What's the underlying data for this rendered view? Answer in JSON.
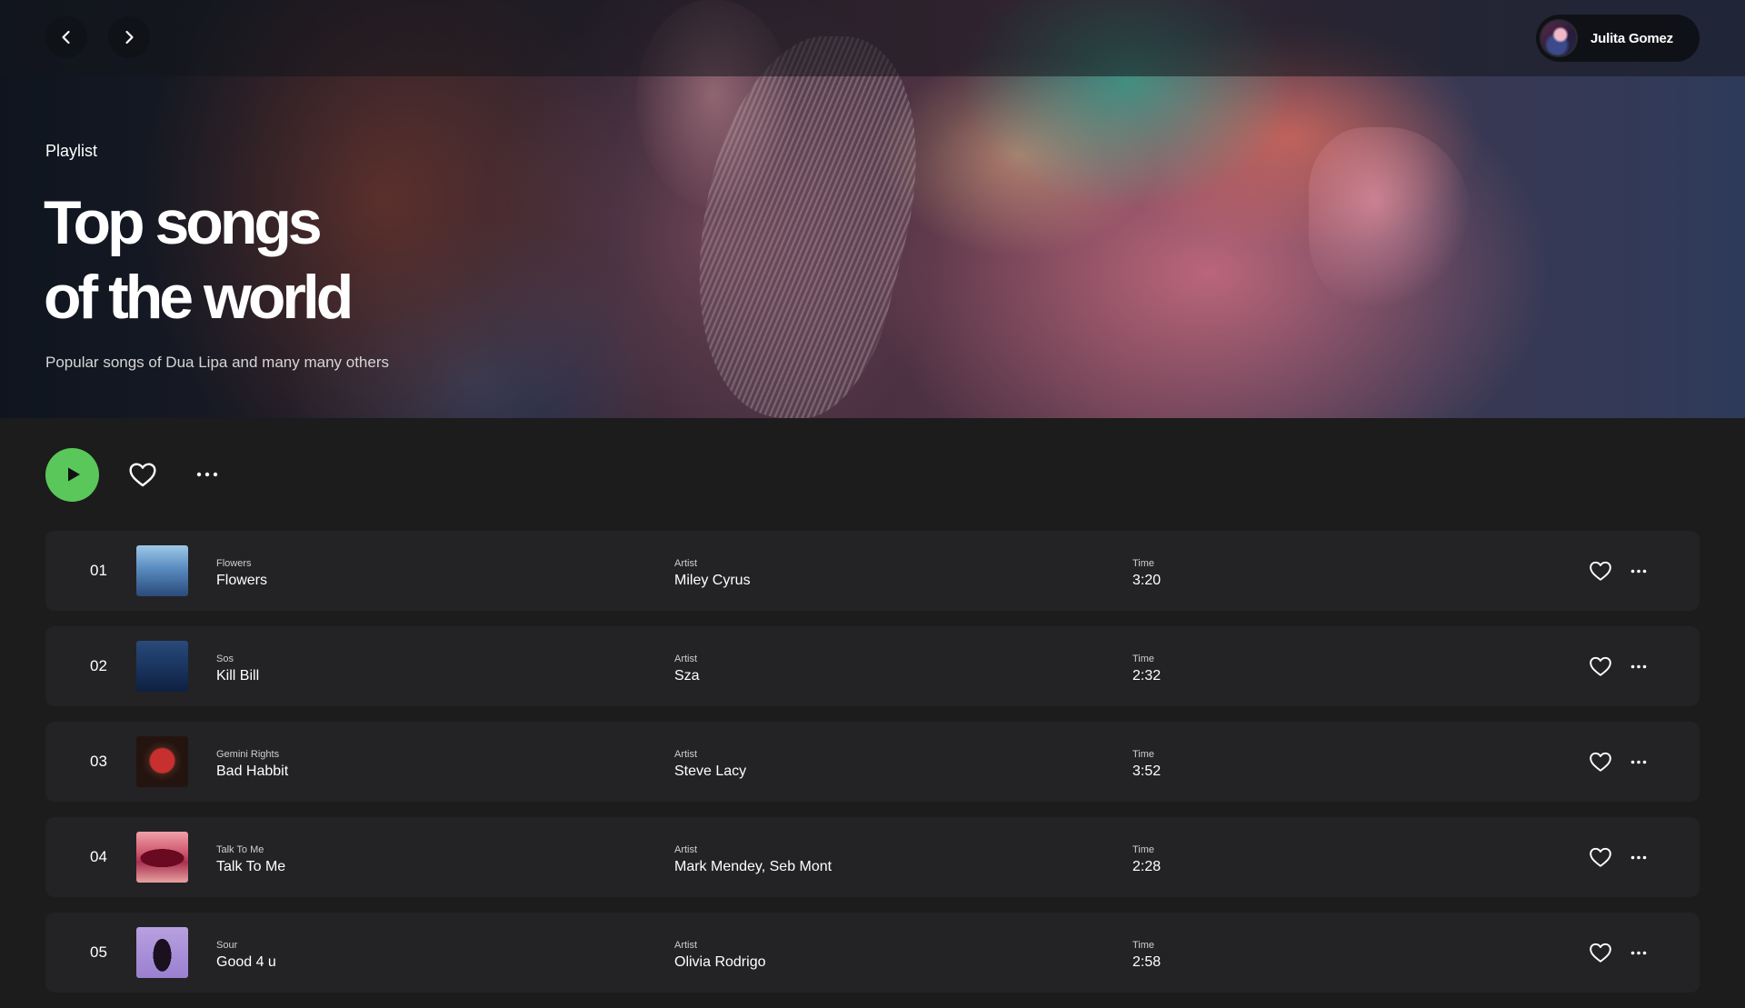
{
  "user": {
    "name": "Julita Gomez"
  },
  "hero": {
    "kicker": "Playlist",
    "title_line1": "Top songs",
    "title_line2": "of the world",
    "subtitle": "Popular songs of Dua Lipa and many many others"
  },
  "icons": {
    "back": "chevron-left-icon",
    "forward": "chevron-right-icon",
    "play": "play-icon",
    "like": "heart-outline-icon",
    "more": "more-horizontal-icon"
  },
  "colors": {
    "accent": "#5ac75a",
    "background": "#1c1c1c",
    "row": "#232325"
  },
  "tracks": [
    {
      "num": "01",
      "album": "Flowers",
      "title": "Flowers",
      "artist_label": "Artist",
      "artist": "Miley Cyrus",
      "time_label": "Time",
      "time": "3:20"
    },
    {
      "num": "02",
      "album": "Sos",
      "title": "Kill Bill",
      "artist_label": "Artist",
      "artist": "Sza",
      "time_label": "Time",
      "time": "2:32"
    },
    {
      "num": "03",
      "album": "Gemini Rights",
      "title": "Bad Habbit",
      "artist_label": "Artist",
      "artist": "Steve Lacy",
      "time_label": "Time",
      "time": "3:52"
    },
    {
      "num": "04",
      "album": "Talk To Me",
      "title": "Talk To Me",
      "artist_label": "Artist",
      "artist": "Mark Mendey, Seb Mont",
      "time_label": "Time",
      "time": "2:28"
    },
    {
      "num": "05",
      "album": "Sour",
      "title": "Good 4 u",
      "artist_label": "Artist",
      "artist": "Olivia Rodrigo",
      "time_label": "Time",
      "time": "2:58"
    }
  ]
}
